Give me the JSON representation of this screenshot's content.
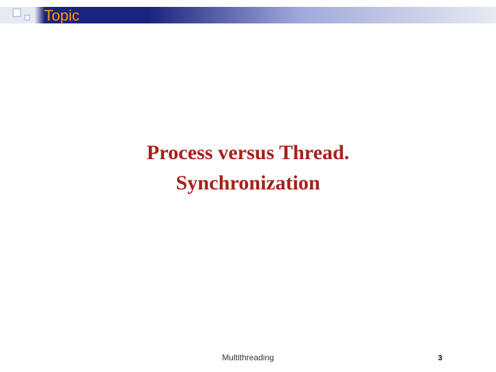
{
  "header": {
    "label": "Topic"
  },
  "content": {
    "line1": "Process versus Thread.",
    "line2": "Synchronization"
  },
  "footer": {
    "title": "Multithreading",
    "page": "3"
  }
}
